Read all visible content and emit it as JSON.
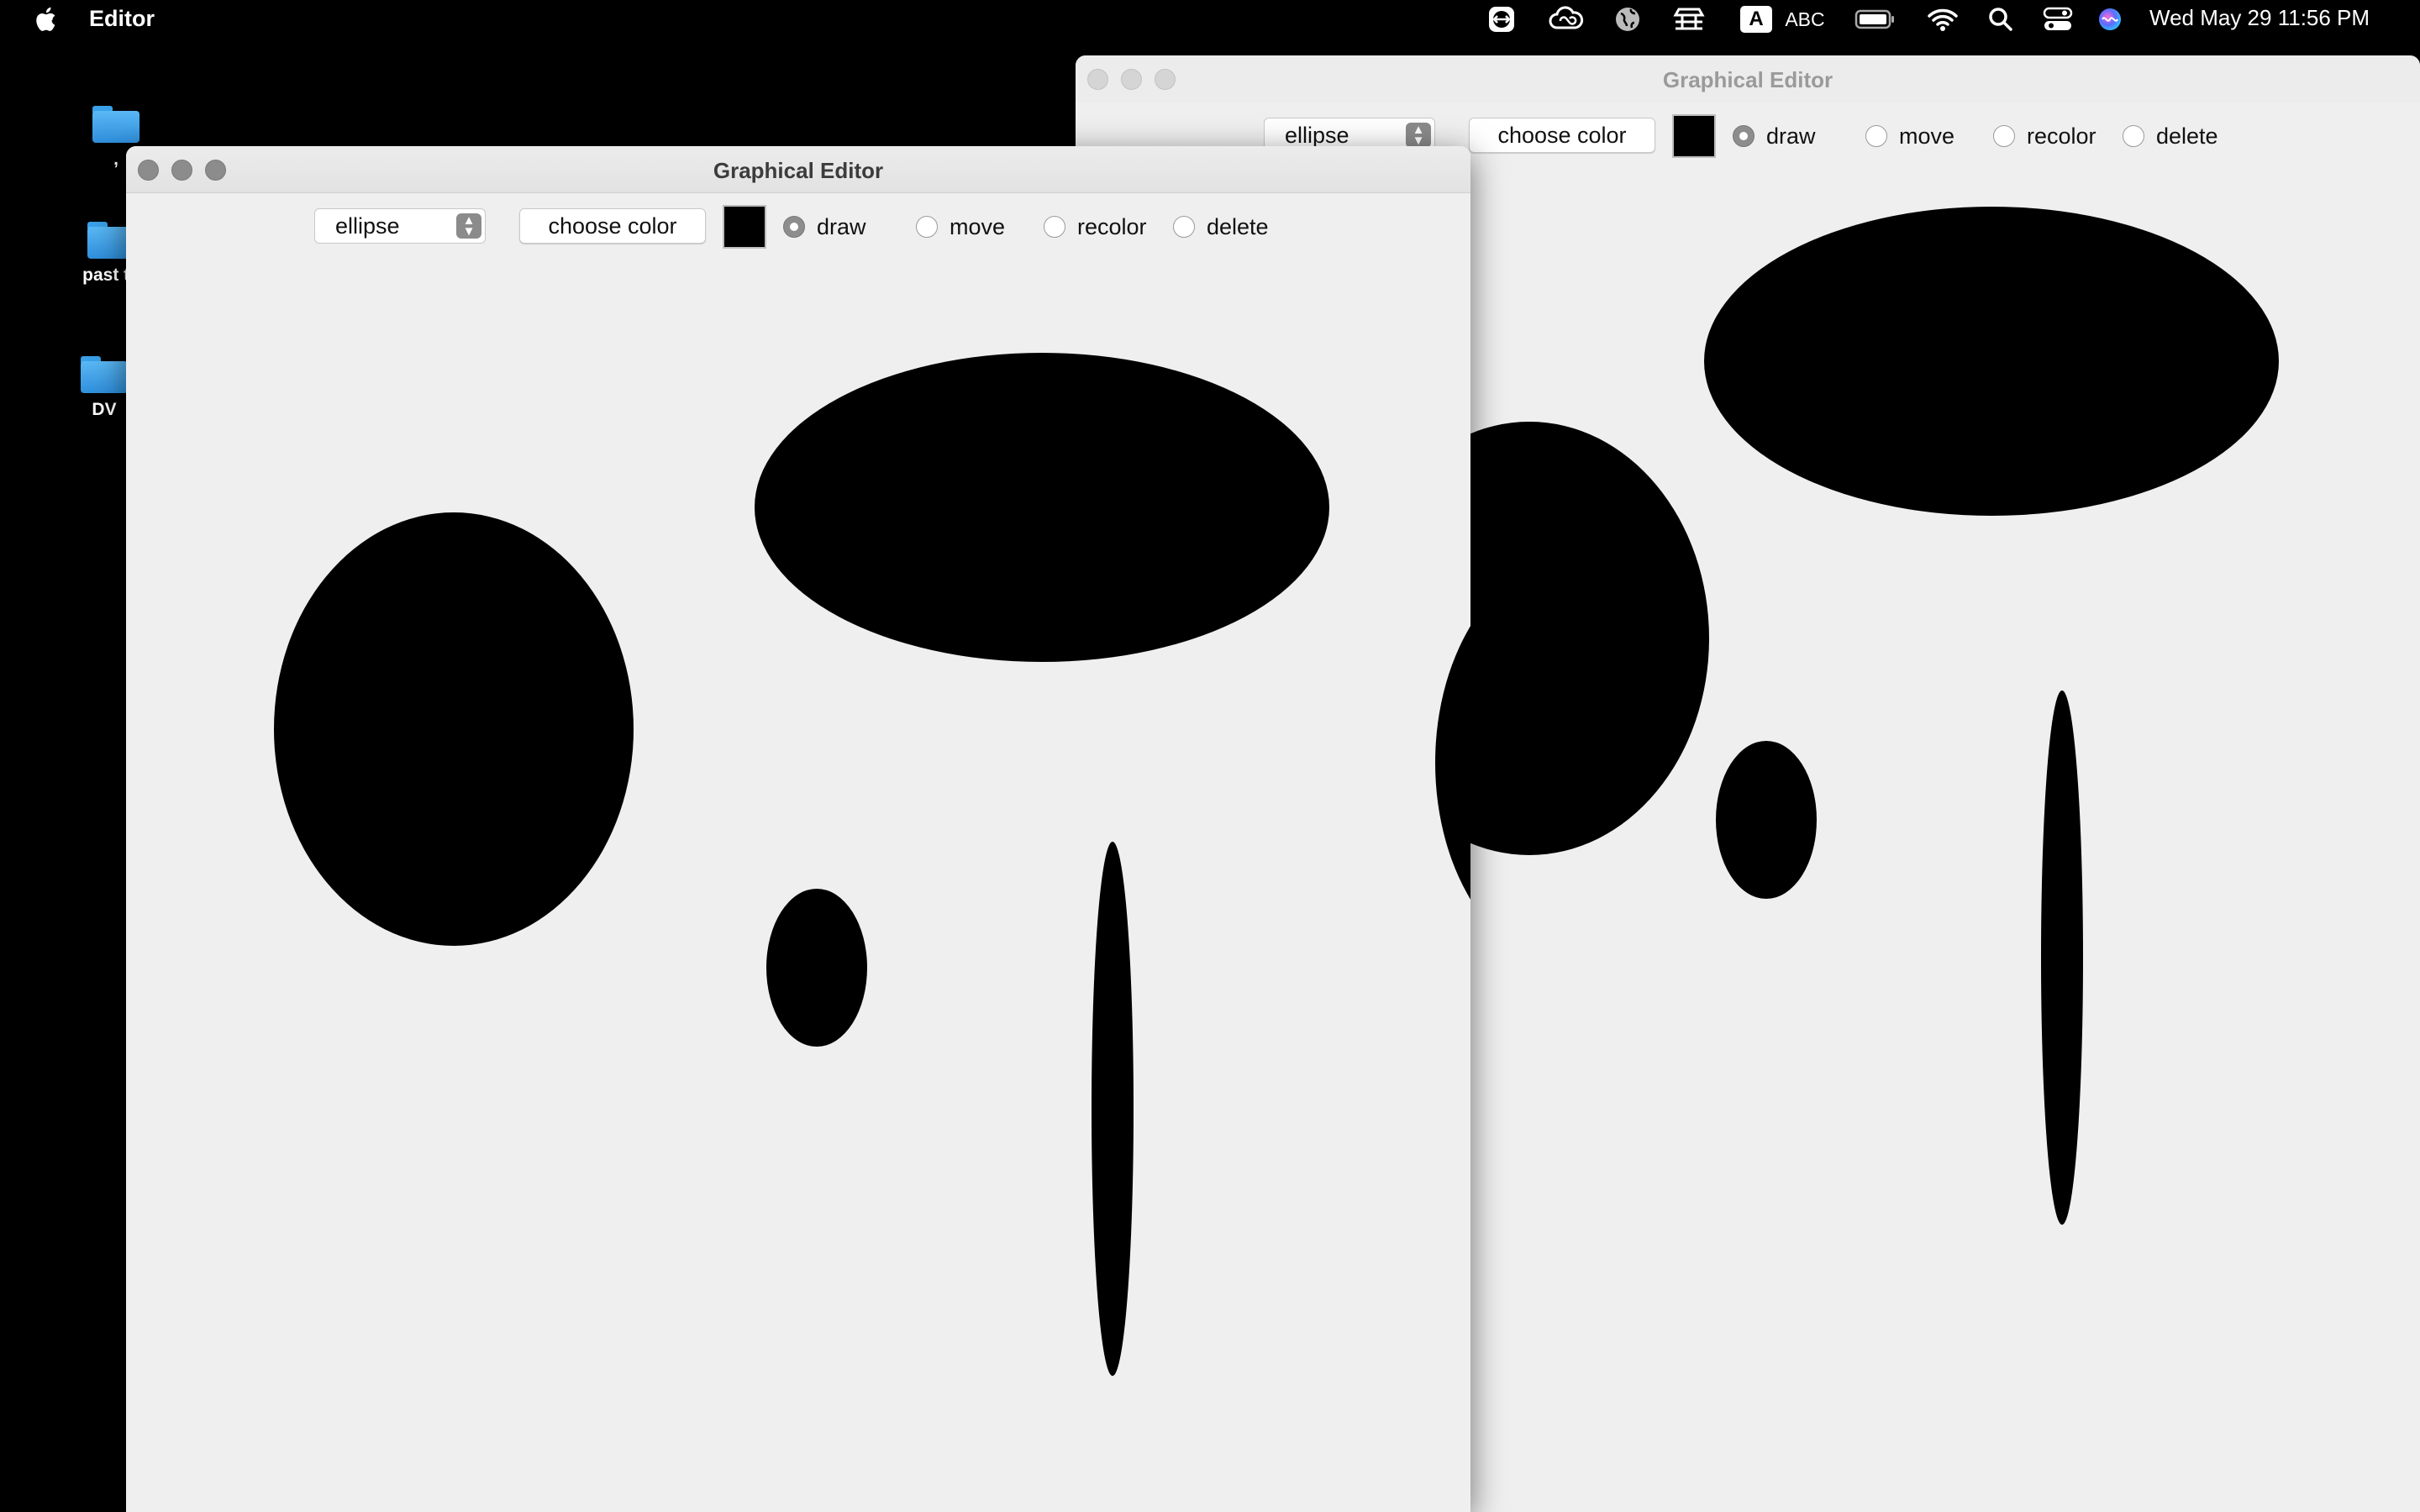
{
  "menubar": {
    "app_name": "Editor",
    "clock": "Wed May 29  11:56 PM",
    "input_source": "A",
    "input_label": "ABC",
    "icons": [
      "teamviewer-icon",
      "creative-cloud-icon",
      "globe-icon",
      "stack-icon",
      "input-source-icon",
      "battery-icon",
      "wifi-icon",
      "search-icon",
      "control-center-icon",
      "siri-icon"
    ]
  },
  "desktop": {
    "items": [
      {
        "label": ","
      },
      {
        "label": "past te"
      },
      {
        "label": "DV"
      }
    ]
  },
  "windows": [
    {
      "title": "Graphical Editor",
      "shape_select": "ellipse",
      "choose_color_label": "choose color",
      "current_color": "#000000",
      "modes": [
        {
          "label": "draw",
          "selected": true
        },
        {
          "label": "move",
          "selected": false
        },
        {
          "label": "recolor",
          "selected": false
        },
        {
          "label": "delete",
          "selected": false
        }
      ],
      "canvas_background": "#efefef",
      "shapes": [
        {
          "type": "ellipse",
          "color": "#000000"
        },
        {
          "type": "ellipse",
          "color": "#000000"
        },
        {
          "type": "ellipse",
          "color": "#000000"
        },
        {
          "type": "ellipse",
          "color": "#000000"
        },
        {
          "type": "ellipse",
          "color": "#000000"
        }
      ]
    },
    {
      "title": "Graphical Editor",
      "shape_select": "ellipse",
      "choose_color_label": "choose color",
      "current_color": "#000000",
      "modes": [
        {
          "label": "draw",
          "selected": true
        },
        {
          "label": "move",
          "selected": false
        },
        {
          "label": "recolor",
          "selected": false
        },
        {
          "label": "delete",
          "selected": false
        }
      ],
      "canvas_background": "#efefef",
      "shapes": [
        {
          "type": "ellipse",
          "color": "#000000"
        },
        {
          "type": "ellipse",
          "color": "#000000"
        },
        {
          "type": "ellipse",
          "color": "#000000"
        },
        {
          "type": "ellipse",
          "color": "#000000"
        }
      ]
    }
  ]
}
